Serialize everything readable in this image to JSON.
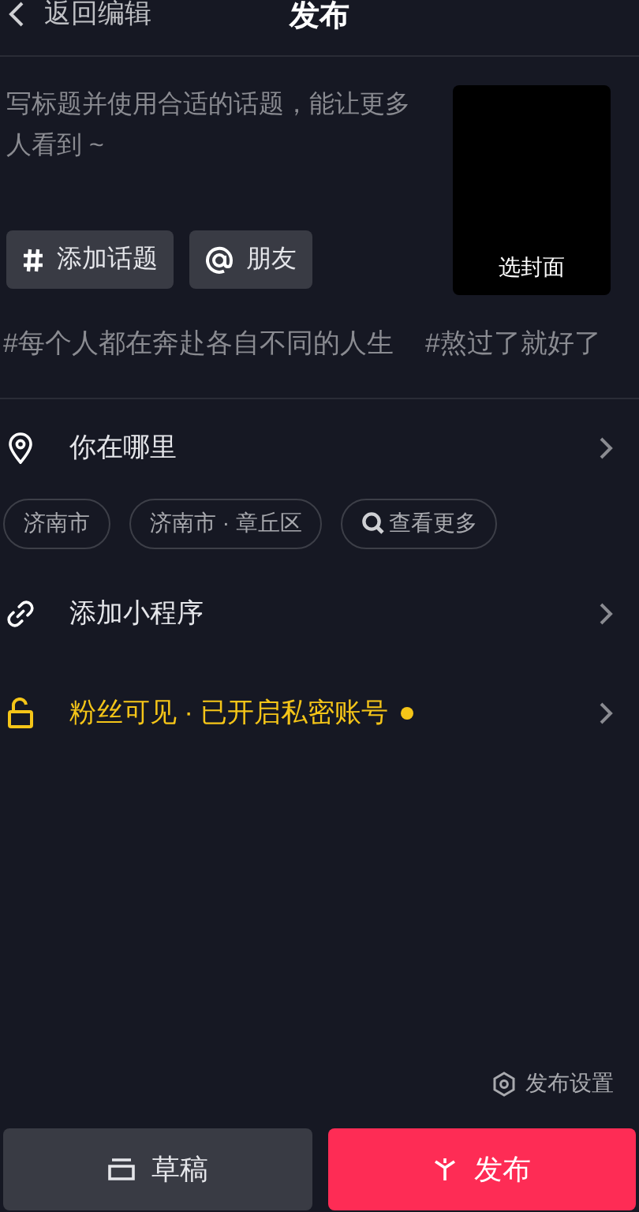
{
  "header": {
    "back_label": "返回编辑",
    "title": "发布"
  },
  "caption": {
    "placeholder": "写标题并使用合适的话题，能让更多人看到 ~"
  },
  "cover": {
    "label": "选封面"
  },
  "insert_buttons": [
    {
      "kind": "hashtag",
      "label": "添加话题"
    },
    {
      "kind": "mention",
      "label": "朋友"
    }
  ],
  "suggested_topics": [
    "#每个人都在奔赴各自不同的人生",
    "#熬过了就好了"
  ],
  "location": {
    "label": "你在哪里",
    "chips": [
      {
        "kind": "place",
        "label": "济南市"
      },
      {
        "kind": "place",
        "label": "济南市 · 章丘区"
      },
      {
        "kind": "search",
        "label": "查看更多"
      }
    ]
  },
  "mini_program": {
    "label": "添加小程序"
  },
  "privacy": {
    "label": "粉丝可见 · 已开启私密账号",
    "highlighted": true
  },
  "settings_link": "发布设置",
  "bottom_buttons": [
    {
      "kind": "draft",
      "label": "草稿"
    },
    {
      "kind": "publish",
      "label": "发布"
    }
  ]
}
